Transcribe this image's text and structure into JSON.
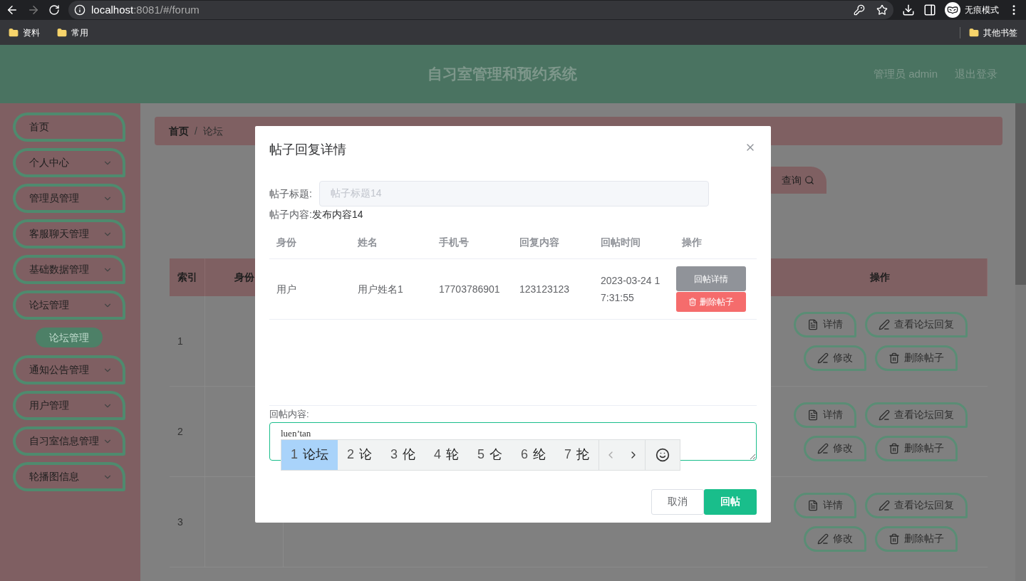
{
  "browser": {
    "url_host": "localhost",
    "url_path": ":8081/#/forum",
    "profile": "无痕模式",
    "bookmarks": [
      "资料",
      "常用"
    ],
    "other_bookmarks": "其他书签"
  },
  "header": {
    "title": "自习室管理和预约系统",
    "user": "管理员 admin",
    "logout": "退出登录"
  },
  "sidebar": {
    "items": [
      {
        "label": "首页",
        "expandable": false
      },
      {
        "label": "个人中心",
        "expandable": true
      },
      {
        "label": "管理员管理",
        "expandable": true
      },
      {
        "label": "客服聊天管理",
        "expandable": true
      },
      {
        "label": "基础数据管理",
        "expandable": true
      },
      {
        "label": "论坛管理",
        "expandable": true,
        "children": [
          {
            "label": "论坛管理",
            "selected": true
          }
        ]
      },
      {
        "label": "通知公告管理",
        "expandable": true
      },
      {
        "label": "用户管理",
        "expandable": true
      },
      {
        "label": "自习室信息管理",
        "expandable": true
      },
      {
        "label": "轮播图信息",
        "expandable": true
      }
    ]
  },
  "breadcrumb": [
    "首页",
    "论坛"
  ],
  "breadcrumb_separator": "/",
  "search_button": "查询",
  "table": {
    "columns": [
      "索引",
      "身份",
      "操作"
    ],
    "rows": [
      {
        "index": "1",
        "actions": [
          {
            "label": "详情",
            "kind": "detail"
          },
          {
            "label": "查看论坛回复",
            "kind": "edit"
          },
          {
            "label": "修改",
            "kind": "edit"
          },
          {
            "label": "删除帖子",
            "kind": "delete"
          }
        ]
      },
      {
        "index": "2",
        "actions": [
          {
            "label": "详情",
            "kind": "detail"
          },
          {
            "label": "查看论坛回复",
            "kind": "edit"
          },
          {
            "label": "修改",
            "kind": "edit"
          },
          {
            "label": "删除帖子",
            "kind": "delete"
          }
        ]
      },
      {
        "index": "3",
        "actions": [
          {
            "label": "详情",
            "kind": "detail"
          },
          {
            "label": "查看论坛回复",
            "kind": "edit"
          },
          {
            "label": "修改",
            "kind": "edit"
          },
          {
            "label": "删除帖子",
            "kind": "delete"
          }
        ]
      }
    ]
  },
  "dialog": {
    "title": "帖子回复详情",
    "title_label": "帖子标题:",
    "title_value": "帖子标题14",
    "content_label": "帖子内容:",
    "content_value": "发布内容14",
    "reply_table": {
      "columns": [
        "身份",
        "姓名",
        "手机号",
        "回复内容",
        "回帖时间",
        "操作"
      ],
      "rows": [
        {
          "cells": [
            "用户",
            "用户姓名1",
            "17703786901",
            "123123123",
            "2023-03-24 17:31:55"
          ],
          "actions": [
            {
              "label": "回帖详情",
              "kind": "detail"
            },
            {
              "label": "删除帖子",
              "kind": "delete"
            }
          ]
        }
      ]
    },
    "reply_label": "回帖内容:",
    "reply_value": "luen’tan",
    "ime": {
      "candidates": [
        {
          "number": "1",
          "text": "论坛",
          "selected": true
        },
        {
          "number": "2",
          "text": "论",
          "selected": false
        },
        {
          "number": "3",
          "text": "伦",
          "selected": false
        },
        {
          "number": "4",
          "text": "轮",
          "selected": false
        },
        {
          "number": "5",
          "text": "仑",
          "selected": false
        },
        {
          "number": "6",
          "text": "纶",
          "selected": false
        },
        {
          "number": "7",
          "text": "抡",
          "selected": false
        }
      ]
    },
    "buttons": [
      {
        "label": "取消",
        "kind": "secondary"
      },
      {
        "label": "回帖",
        "kind": "primary"
      }
    ]
  }
}
